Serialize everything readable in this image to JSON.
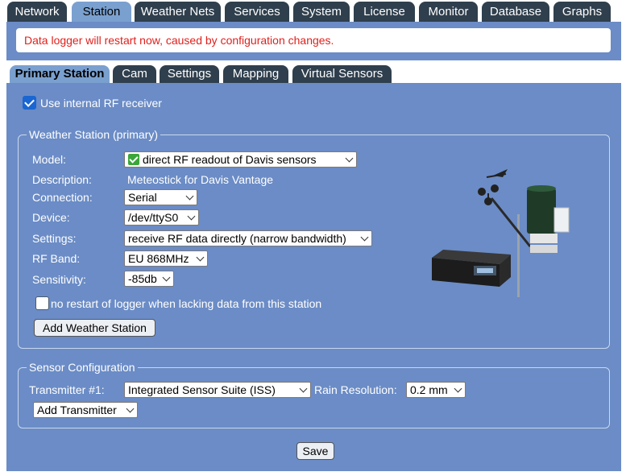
{
  "top_tabs": [
    {
      "label": "Network",
      "active": false
    },
    {
      "label": "Station",
      "active": true
    },
    {
      "label": "Weather Nets",
      "active": false
    },
    {
      "label": "Services",
      "active": false
    },
    {
      "label": "System",
      "active": false
    },
    {
      "label": "License",
      "active": false
    },
    {
      "label": "Monitor",
      "active": false
    },
    {
      "label": "Database",
      "active": false
    },
    {
      "label": "Graphs",
      "active": false
    }
  ],
  "notice": "Data logger will restart now, caused by configuration changes.",
  "sub_tabs": [
    {
      "label": "Primary Station",
      "active": true
    },
    {
      "label": "Cam",
      "active": false
    },
    {
      "label": "Settings",
      "active": false
    },
    {
      "label": "Mapping",
      "active": false
    },
    {
      "label": "Virtual Sensors",
      "active": false
    }
  ],
  "use_internal_rf": {
    "label": "Use internal RF receiver",
    "checked": true
  },
  "weather_station": {
    "legend": "Weather Station (primary)",
    "model": {
      "label": "Model:",
      "value": "direct RF readout of Davis sensors",
      "icon": "check-mark-icon"
    },
    "description": {
      "label": "Description:",
      "value": "Meteostick for Davis Vantage"
    },
    "connection": {
      "label": "Connection:",
      "value": "Serial"
    },
    "device": {
      "label": "Device:",
      "value": "/dev/ttyS0"
    },
    "settings": {
      "label": "Settings:",
      "value": "receive RF data directly (narrow bandwidth)"
    },
    "rf_band": {
      "label": "RF Band:",
      "value": "EU 868MHz"
    },
    "sensitivity": {
      "label": "Sensitivity:",
      "value": "-85db"
    },
    "no_restart": {
      "label": "no restart of logger when lacking data from this station",
      "checked": false
    },
    "add_button": "Add Weather Station"
  },
  "sensor_config": {
    "legend": "Sensor Configuration",
    "transmitter": {
      "label": "Transmitter #1:",
      "value": "Integrated Sensor Suite (ISS)"
    },
    "rain_resolution": {
      "label": "Rain Resolution:",
      "value": "0.2 mm"
    },
    "add_transmitter": "Add Transmitter"
  },
  "save_button": "Save",
  "colors": {
    "panel_bg": "#6b8cc6",
    "tab_dark": "#2f3f4d",
    "tab_active": "#7aa0cf",
    "notice_text": "#e0201c"
  }
}
